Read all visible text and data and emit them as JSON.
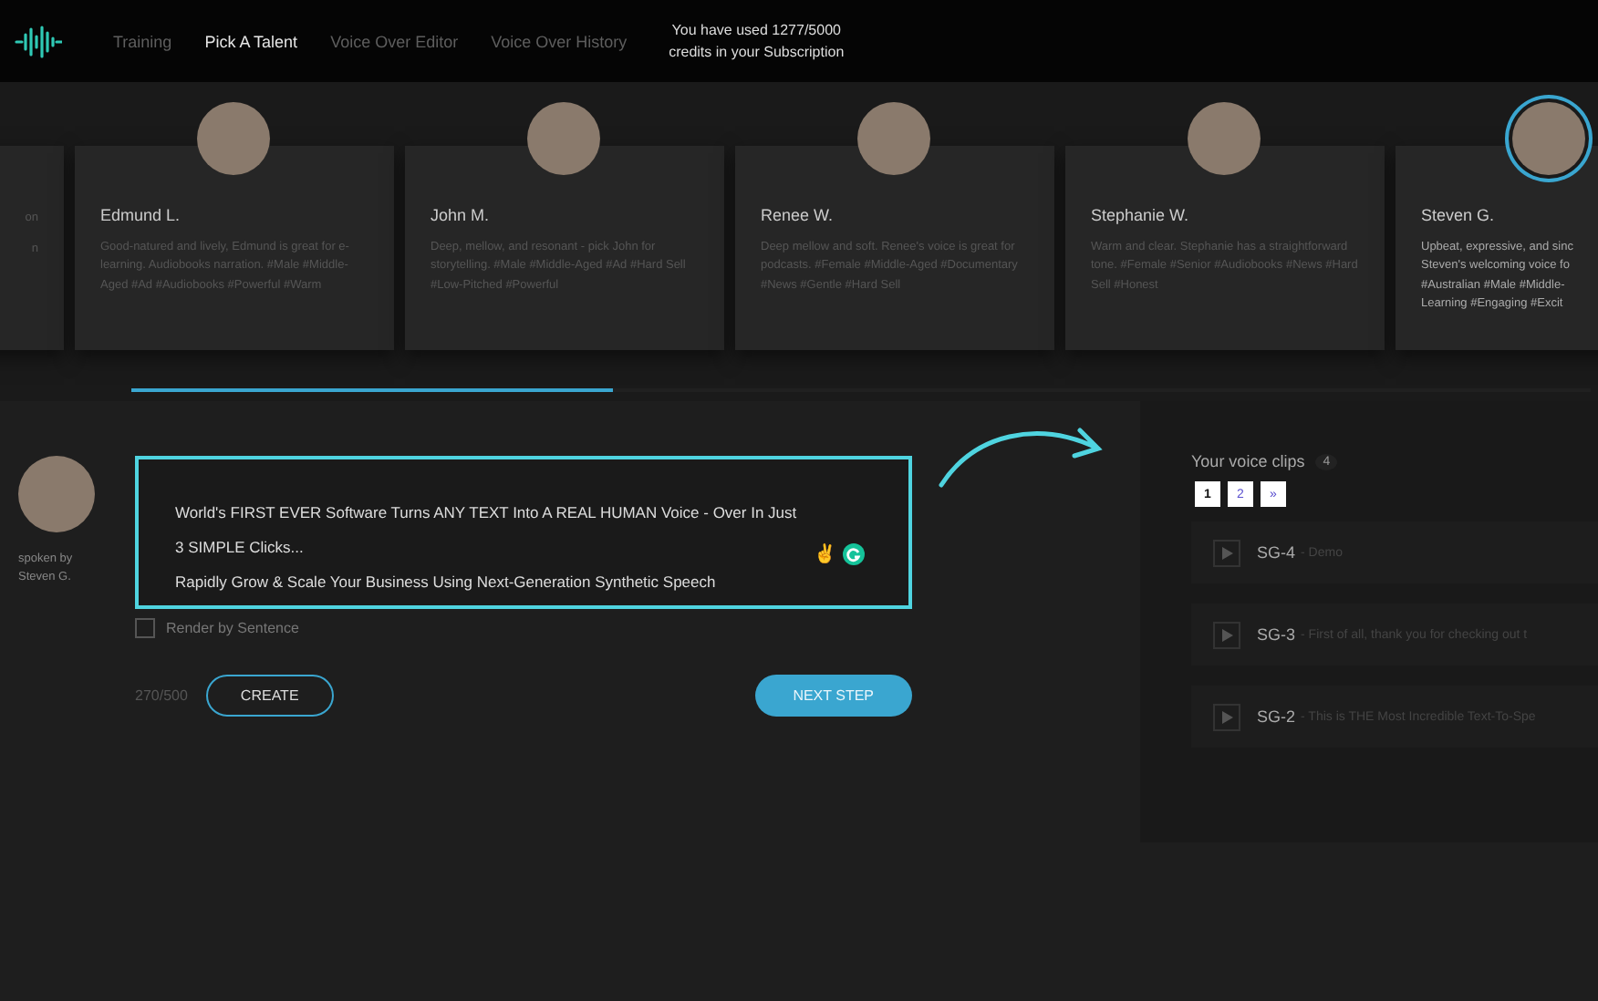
{
  "nav": {
    "tabs": [
      {
        "label": "Training",
        "selected": false
      },
      {
        "label": "Pick A Talent",
        "selected": true
      },
      {
        "label": "Voice Over Editor",
        "selected": false
      },
      {
        "label": "Voice Over History",
        "selected": false
      }
    ],
    "credits": "You have used 1277/5000 credits in your Subscription"
  },
  "talents": [
    {
      "kind": "cut-left",
      "description_lines": [
        "on",
        "n"
      ]
    },
    {
      "kind": "full",
      "name": "Edmund L.",
      "description_lines": [
        "Good-natured and lively, Edmund is great for e-learning. Audiobooks narration. #Male #Middle-Aged #Ad #Audiobooks #Powerful #Warm"
      ],
      "selected": false
    },
    {
      "kind": "full",
      "name": "John M.",
      "description_lines": [
        "Deep, mellow, and resonant - pick John for storytelling. #Male #Middle-Aged #Ad #Hard Sell #Low-Pitched #Powerful"
      ],
      "selected": false
    },
    {
      "kind": "full",
      "name": "Renee W.",
      "description_lines": [
        "Deep mellow and soft. Renee's voice is great for podcasts. #Female #Middle-Aged #Documentary #News #Gentle #Hard Sell"
      ],
      "selected": false
    },
    {
      "kind": "full",
      "name": "Stephanie W.",
      "description_lines": [
        "Warm and clear. Stephanie has a straightforward tone. #Female #Senior #Audiobooks #News #Hard Sell #Honest"
      ],
      "selected": false
    },
    {
      "kind": "cut-right",
      "name": "Steven G.",
      "description_lines": [
        "Upbeat, expressive, and sinc",
        "Steven's welcoming voice fo",
        "#Australian #Male #Middle-",
        "Learning #Engaging #Excit"
      ],
      "selected": true
    }
  ],
  "carousel": {
    "level": 0.33
  },
  "speaker": {
    "label": "spoken by",
    "name": "Steven G."
  },
  "editor": {
    "paragraphs": [
      "World's FIRST EVER Software Turns ANY TEXT Into A REAL HUMAN Voice - Over In Just 3 SIMPLE Clicks...",
      "Rapidly Grow & Scale Your Business Using Next-Generation Synthetic Speech"
    ],
    "emoji": "✌"
  },
  "render_by_sentence": {
    "label": "Render by Sentence",
    "checked": false
  },
  "counter": "270/500",
  "create_button": "CREATE",
  "next_button": "NEXT STEP",
  "clips": {
    "title": "Your voice clips",
    "count": "4",
    "pages": [
      {
        "label": "1",
        "selected": true
      },
      {
        "label": "2",
        "selected": false
      },
      {
        "label": "»",
        "selected": false
      }
    ],
    "items": [
      {
        "name": "SG-4",
        "text": "- Demo"
      },
      {
        "name": "SG-3",
        "text": "- First of all, thank you for checking out t"
      },
      {
        "name": "SG-2",
        "text": "- This is THE Most Incredible Text-To-Spe"
      }
    ]
  }
}
